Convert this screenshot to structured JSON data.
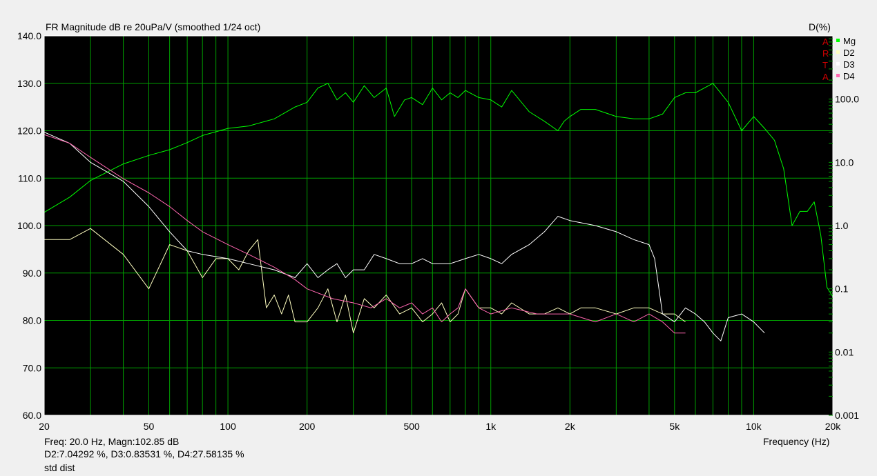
{
  "header": {
    "title": "FR Magnitude dB re 20uPa/V (smoothed 1/24 oct)",
    "right_axis_title": "D(%)",
    "x_axis_title": "Frequency (Hz)"
  },
  "status": {
    "line1": "Freq: 20.0 Hz, Magn:102.85 dB",
    "line2": "D2:7.04292 %, D3:0.83531 %, D4:27.58135 %",
    "line3": "std dist"
  },
  "watermark": [
    "A",
    "R",
    "T",
    "A"
  ],
  "colors": {
    "background": "#000000",
    "grid": "#00a000",
    "frame": "#ffffff",
    "Mg": "#00ff00",
    "D2": "#ffffc0",
    "D3": "#ffffff",
    "D4": "#ff66b0",
    "watermark": "#cc0000"
  },
  "chart_data": {
    "type": "line",
    "x_scale": "log",
    "xlim": [
      20,
      20000
    ],
    "xticks": [
      20,
      50,
      100,
      200,
      500,
      1000,
      2000,
      5000,
      10000,
      20000
    ],
    "xtick_labels": [
      "20",
      "50",
      "100",
      "200",
      "500",
      "1k",
      "2k",
      "5k",
      "10k",
      "20k"
    ],
    "ylim": [
      60,
      140
    ],
    "yticks": [
      60,
      70,
      80,
      90,
      100,
      110,
      120,
      130,
      140
    ],
    "ytick_labels": [
      "60.0",
      "70.0",
      "80.0",
      "90.0",
      "100.0",
      "110.0",
      "120.0",
      "130.0",
      "140.0"
    ],
    "y2_scale": "log",
    "y2lim": [
      0.001,
      1000
    ],
    "y2ticks": [
      0.001,
      0.01,
      0.1,
      1,
      10,
      100
    ],
    "y2tick_labels": [
      "0.001",
      "0.01",
      "0.1",
      "1.0",
      "10.0",
      "100.0"
    ],
    "grid": true,
    "legend_position": "top-right",
    "series": [
      {
        "name": "Mg",
        "axis": "left",
        "x": [
          20,
          25,
          30,
          40,
          50,
          60,
          70,
          80,
          100,
          120,
          150,
          180,
          200,
          220,
          240,
          260,
          280,
          300,
          330,
          360,
          400,
          430,
          470,
          500,
          550,
          600,
          650,
          700,
          750,
          800,
          900,
          1000,
          1100,
          1200,
          1400,
          1600,
          1800,
          1900,
          2000,
          2200,
          2500,
          3000,
          3500,
          4000,
          4500,
          5000,
          5500,
          6000,
          7000,
          8000,
          9000,
          10000,
          11000,
          12000,
          13000,
          14000,
          15000,
          16000,
          17000,
          18000,
          19000,
          20000
        ],
        "y": [
          102.8,
          106,
          109.5,
          113,
          114.8,
          116,
          117.5,
          119,
          120.5,
          121,
          122.5,
          125,
          126,
          129,
          130,
          126.5,
          128,
          126,
          129.5,
          127,
          129,
          123,
          126.5,
          127,
          125.5,
          129,
          126.5,
          128,
          127,
          128.5,
          127,
          126.5,
          125,
          128.5,
          124,
          122,
          120,
          122,
          123,
          124.5,
          124.5,
          123,
          122.5,
          122.5,
          123.5,
          127,
          128,
          128,
          130,
          126,
          120,
          123,
          120.5,
          118,
          112,
          100,
          103,
          103,
          105,
          98,
          87,
          85
        ]
      },
      {
        "name": "D2",
        "axis": "right",
        "x": [
          20,
          25,
          30,
          40,
          50,
          60,
          70,
          80,
          90,
          100,
          110,
          120,
          130,
          140,
          150,
          160,
          170,
          180,
          200,
          220,
          240,
          260,
          280,
          300,
          330,
          360,
          400,
          450,
          500,
          550,
          600,
          650,
          700,
          750,
          800,
          900,
          1000,
          1100,
          1200,
          1400,
          1600,
          1800,
          2000,
          2200,
          2500,
          3000,
          3500,
          4000,
          4500,
          5000,
          5500
        ],
        "y": [
          0.6,
          0.6,
          0.9,
          0.35,
          0.1,
          0.5,
          0.4,
          0.15,
          0.3,
          0.3,
          0.2,
          0.4,
          0.6,
          0.05,
          0.08,
          0.04,
          0.08,
          0.03,
          0.03,
          0.05,
          0.1,
          0.03,
          0.08,
          0.02,
          0.07,
          0.05,
          0.08,
          0.04,
          0.05,
          0.03,
          0.04,
          0.06,
          0.03,
          0.04,
          0.1,
          0.05,
          0.05,
          0.04,
          0.06,
          0.04,
          0.04,
          0.05,
          0.04,
          0.05,
          0.05,
          0.04,
          0.05,
          0.05,
          0.04,
          0.04,
          0.03
        ]
      },
      {
        "name": "D3",
        "axis": "right",
        "x": [
          20,
          25,
          30,
          40,
          50,
          60,
          70,
          80,
          100,
          120,
          150,
          180,
          200,
          220,
          240,
          260,
          280,
          300,
          330,
          360,
          400,
          450,
          500,
          550,
          600,
          700,
          800,
          900,
          1000,
          1100,
          1200,
          1400,
          1600,
          1800,
          2000,
          2500,
          3000,
          3500,
          4000,
          4200,
          4500,
          5000,
          5500,
          6000,
          6500,
          7000,
          7500,
          8000,
          9000,
          10000,
          11000
        ],
        "y": [
          30,
          20,
          10,
          5,
          2,
          0.8,
          0.4,
          0.35,
          0.3,
          0.25,
          0.2,
          0.15,
          0.25,
          0.15,
          0.2,
          0.25,
          0.15,
          0.2,
          0.2,
          0.35,
          0.3,
          0.25,
          0.25,
          0.3,
          0.25,
          0.25,
          0.3,
          0.35,
          0.3,
          0.25,
          0.35,
          0.5,
          0.8,
          1.4,
          1.2,
          1.0,
          0.8,
          0.6,
          0.5,
          0.3,
          0.04,
          0.03,
          0.05,
          0.04,
          0.03,
          0.02,
          0.015,
          0.035,
          0.04,
          0.03,
          0.02
        ]
      },
      {
        "name": "D4",
        "axis": "right",
        "x": [
          20,
          25,
          30,
          40,
          50,
          60,
          70,
          80,
          100,
          120,
          150,
          180,
          200,
          250,
          300,
          350,
          400,
          450,
          500,
          550,
          600,
          650,
          700,
          750,
          800,
          900,
          1000,
          1200,
          1500,
          2000,
          2500,
          3000,
          3500,
          4000,
          4500,
          5000,
          5500
        ],
        "y": [
          27.5,
          20,
          12,
          5.5,
          3.3,
          2.0,
          1.2,
          0.8,
          0.5,
          0.35,
          0.22,
          0.14,
          0.1,
          0.07,
          0.06,
          0.05,
          0.07,
          0.05,
          0.06,
          0.04,
          0.05,
          0.03,
          0.04,
          0.05,
          0.1,
          0.05,
          0.04,
          0.05,
          0.04,
          0.04,
          0.03,
          0.04,
          0.03,
          0.04,
          0.03,
          0.02,
          0.02
        ]
      }
    ]
  }
}
